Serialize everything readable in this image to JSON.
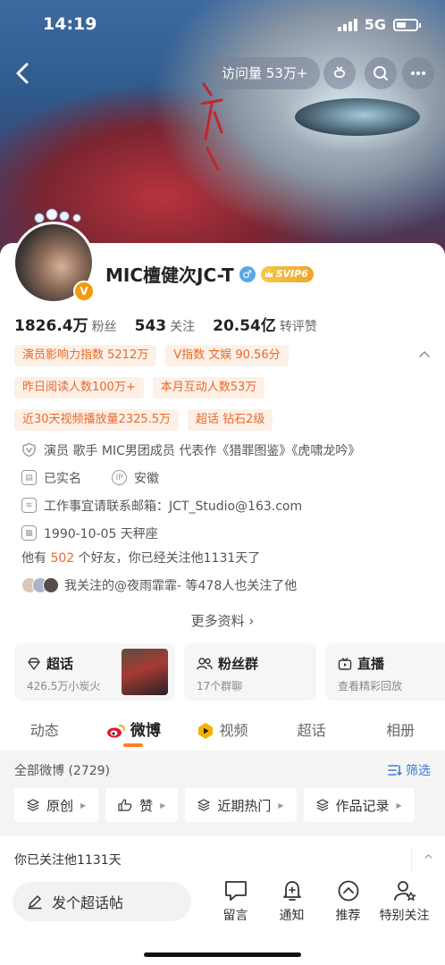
{
  "status_bar": {
    "time": "14:19",
    "network": "5G"
  },
  "nav": {
    "visits_label": "访问量 53万+"
  },
  "profile": {
    "name": "MIC檀健次JC-T",
    "gender_symbol": "♂",
    "svip_label": "SVIP6",
    "verified_symbol": "V"
  },
  "stats": [
    {
      "value": "1826.4万",
      "label": "粉丝"
    },
    {
      "value": "543",
      "label": "关注"
    },
    {
      "value": "20.54亿",
      "label": "转评赞"
    }
  ],
  "tags": {
    "row1": [
      "演员影响力指数 5212万",
      "V指数 文娱 90.56分"
    ],
    "row2": [
      "昨日阅读人数100万+",
      "本月互动人数53万"
    ],
    "row3": [
      "近30天视频播放量2325.5万",
      "超话 钻石2级"
    ]
  },
  "info": {
    "description": "演员 歌手 MIC男团成员 代表作《猎罪图鉴》《虎啸龙吟》",
    "real_name": "已实名",
    "ip_location": "安徽",
    "contact": "工作事宜请联系邮箱：JCT_Studio@163.com",
    "birthday": "1990-10-05 天秤座"
  },
  "friends": {
    "prefix": "他有",
    "count": "502",
    "suffix": "个好友，你已经关注他1131天了"
  },
  "mutual": {
    "text": "我关注的@夜雨霏霏- 等478人也关注了他"
  },
  "more_info_label": "更多资料",
  "features": [
    {
      "title": "超话",
      "subtitle": "426.5万小炭火"
    },
    {
      "title": "粉丝群",
      "subtitle": "17个群聊"
    },
    {
      "title": "直播",
      "subtitle": "查看精彩回放"
    }
  ],
  "tabs": [
    "动态",
    "微博",
    "视频",
    "超话",
    "相册"
  ],
  "feed": {
    "count_label": "全部微博 (2729)",
    "filter_label": "筛选",
    "chips": [
      "原创",
      "赞",
      "近期热门",
      "作品记录"
    ]
  },
  "followed_label": "你已关注他1131天",
  "bottom": {
    "compose_label": "发个超话帖",
    "actions": [
      "留言",
      "通知",
      "推荐",
      "特别关注"
    ]
  }
}
